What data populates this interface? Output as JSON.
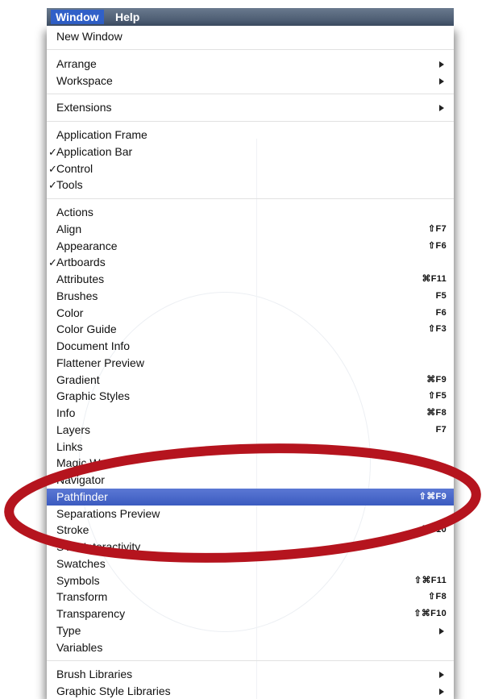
{
  "menubar": {
    "window_label": "Window",
    "help_label": "Help"
  },
  "menu": {
    "groups": [
      [
        {
          "label": "New Window"
        }
      ],
      [
        {
          "label": "Arrange",
          "submenu": true
        },
        {
          "label": "Workspace",
          "submenu": true
        }
      ],
      [
        {
          "label": "Extensions",
          "submenu": true
        }
      ],
      [
        {
          "label": "Application Frame"
        },
        {
          "label": "Application Bar",
          "checked": true
        },
        {
          "label": "Control",
          "checked": true
        },
        {
          "label": "Tools",
          "checked": true
        }
      ],
      [
        {
          "label": "Actions"
        },
        {
          "label": "Align",
          "shortcut": "⇧F7"
        },
        {
          "label": "Appearance",
          "shortcut": "⇧F6"
        },
        {
          "label": "Artboards",
          "checked": true
        },
        {
          "label": "Attributes",
          "shortcut": "⌘F11"
        },
        {
          "label": "Brushes",
          "shortcut": "F5"
        },
        {
          "label": "Color",
          "shortcut": "F6"
        },
        {
          "label": "Color Guide",
          "shortcut": "⇧F3"
        },
        {
          "label": "Document Info"
        },
        {
          "label": "Flattener Preview"
        },
        {
          "label": "Gradient",
          "shortcut": "⌘F9"
        },
        {
          "label": "Graphic Styles",
          "shortcut": "⇧F5"
        },
        {
          "label": "Info",
          "shortcut": "⌘F8"
        },
        {
          "label": "Layers",
          "shortcut": "F7"
        },
        {
          "label": "Links"
        },
        {
          "label": "Magic Wand"
        },
        {
          "label": "Navigator"
        },
        {
          "label": "Pathfinder",
          "shortcut": "⇧⌘F9",
          "highlighted": true
        },
        {
          "label": "Separations Preview"
        },
        {
          "label": "Stroke",
          "shortcut": "⌘F10"
        },
        {
          "label": "SVG Interactivity"
        },
        {
          "label": "Swatches"
        },
        {
          "label": "Symbols",
          "shortcut": "⇧⌘F11"
        },
        {
          "label": "Transform",
          "shortcut": "⇧F8"
        },
        {
          "label": "Transparency",
          "shortcut": "⇧⌘F10"
        },
        {
          "label": "Type",
          "submenu": true
        },
        {
          "label": "Variables"
        }
      ],
      [
        {
          "label": "Brush Libraries",
          "submenu": true
        },
        {
          "label": "Graphic Style Libraries",
          "submenu": true
        }
      ]
    ]
  },
  "colors": {
    "highlight": "#3b5bc0",
    "annotation_ring": "#b5141e",
    "menubar": "#3f4f66"
  }
}
